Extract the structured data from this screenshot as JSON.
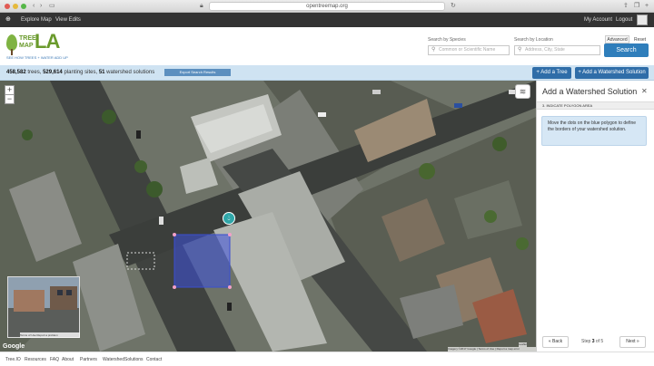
{
  "browser": {
    "url": "opentreemap.org"
  },
  "topnav": {
    "left_items": [
      "Explore Map",
      "View Edits"
    ],
    "my_account": "My Account",
    "logout": "Logout"
  },
  "header": {
    "logo_tree": "TREE",
    "logo_map": "MAP",
    "logo_la": "LA",
    "logo_tagline": "SEE HOW TREES + WATER ADD UP",
    "species_label": "Search by Species",
    "species_placeholder": "Common or Scientific Name",
    "location_label": "Search by Location",
    "location_placeholder": "Address, City, State",
    "advanced": "Advanced",
    "reset": "Reset",
    "search": "Search"
  },
  "stats": {
    "trees_count": "458,582",
    "trees_label": "trees,",
    "planting_count": "529,614",
    "planting_label": "planting sites,",
    "watershed_count": "51",
    "watershed_label": "watershed solutions",
    "export": "Export Search Results",
    "add_tree": "Add a Tree",
    "add_watershed": "Add a Watershed Solution"
  },
  "map": {
    "zoom_in": "+",
    "zoom_out": "−",
    "google": "Google",
    "sv_terms": "Terms of Use",
    "sv_report": "Report a problem",
    "attribution": "Imagery ©2017 Google | Terms of Use | Report a map error",
    "leaflet": "Leaflet"
  },
  "panel": {
    "title": "Add a Watershed Solution",
    "step_header": "3. INDICATE POLYGON AREA",
    "instructions": "Move the dots on the blue polygon to define the borders of your watershed solution.",
    "back": "« Back",
    "step_word": "Step",
    "step_current": "3",
    "step_of": "of 5",
    "next": "Next »"
  },
  "footer": {
    "items": [
      "Tree.IO",
      "Resources",
      "FAQ",
      "About",
      "Partners",
      "WatershedSolutions",
      "Contact"
    ]
  },
  "colors": {
    "brand_green": "#6a9a2c",
    "primary_blue": "#2f6da8",
    "polygon_blue": "#3b4fd0",
    "marker_teal": "#2fa6a8"
  }
}
